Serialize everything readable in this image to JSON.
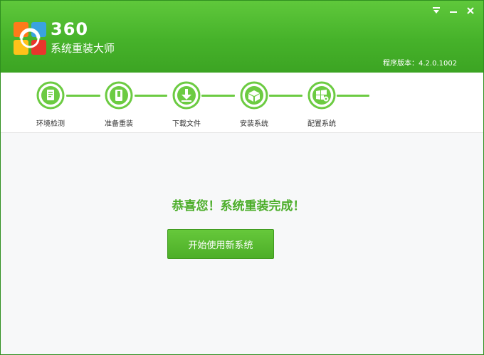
{
  "header": {
    "brand_number": "360",
    "brand_name": "系统重装大师",
    "version": "程序版本：4.2.0.1002"
  },
  "window_controls": {
    "menu_icon": "menu-icon",
    "minimize_icon": "minimize-icon",
    "close_icon": "close-icon"
  },
  "steps": [
    {
      "label": "环境检测",
      "icon": "document-check-icon"
    },
    {
      "label": "准备重装",
      "icon": "device-icon"
    },
    {
      "label": "下载文件",
      "icon": "download-icon"
    },
    {
      "label": "安装系统",
      "icon": "install-box-icon"
    },
    {
      "label": "配置系统",
      "icon": "windows-gear-icon"
    }
  ],
  "main": {
    "success_message": "恭喜您！系统重装完成！",
    "start_button_label": "开始使用新系统"
  },
  "colors": {
    "header_green": "#46b22a",
    "accent_green": "#4cae2a",
    "step_green": "#6ccb42"
  }
}
